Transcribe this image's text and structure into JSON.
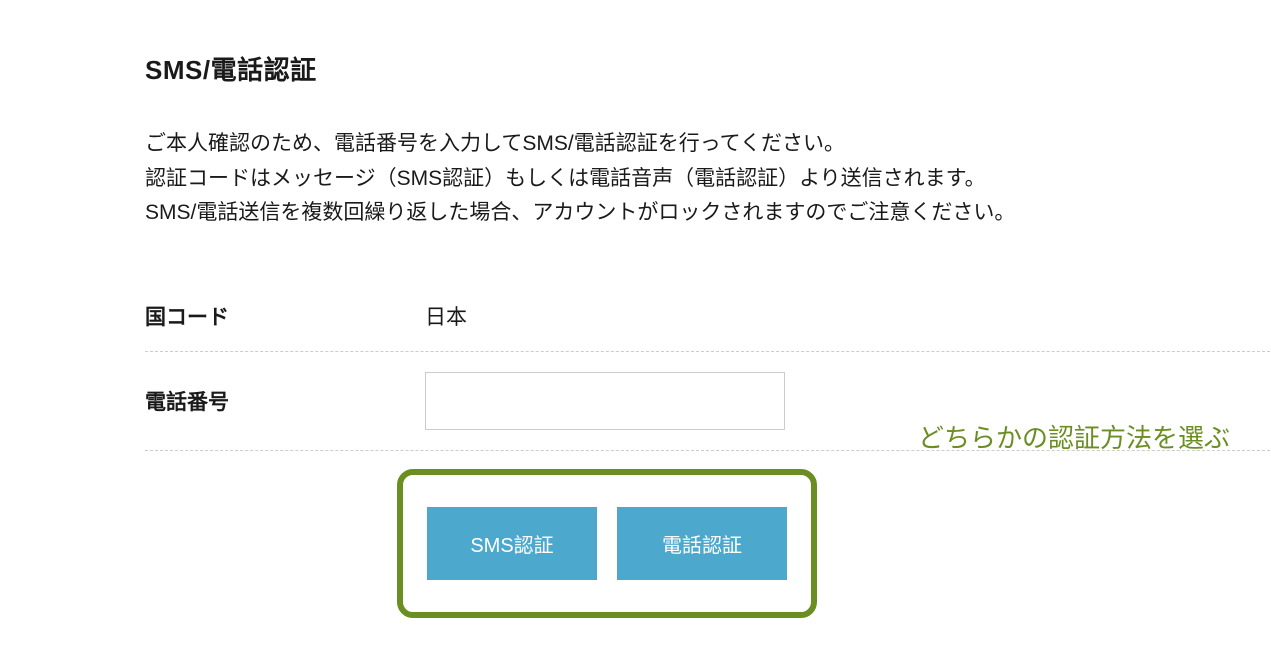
{
  "title": "SMS/電話認証",
  "description": {
    "line1": "ご本人確認のため、電話番号を入力してSMS/電話認証を行ってください。",
    "line2": "認証コードはメッセージ（SMS認証）もしくは電話音声（電話認証）より送信されます。",
    "line3": "SMS/電話送信を複数回繰り返した場合、アカウントがロックされますのでご注意ください。"
  },
  "form": {
    "country_code_label": "国コード",
    "country_code_value": "日本",
    "phone_label": "電話番号",
    "phone_value": ""
  },
  "helper_text": "どちらかの認証方法を選ぶ",
  "buttons": {
    "sms_label": "SMS認証",
    "phone_label": "電話認証"
  }
}
